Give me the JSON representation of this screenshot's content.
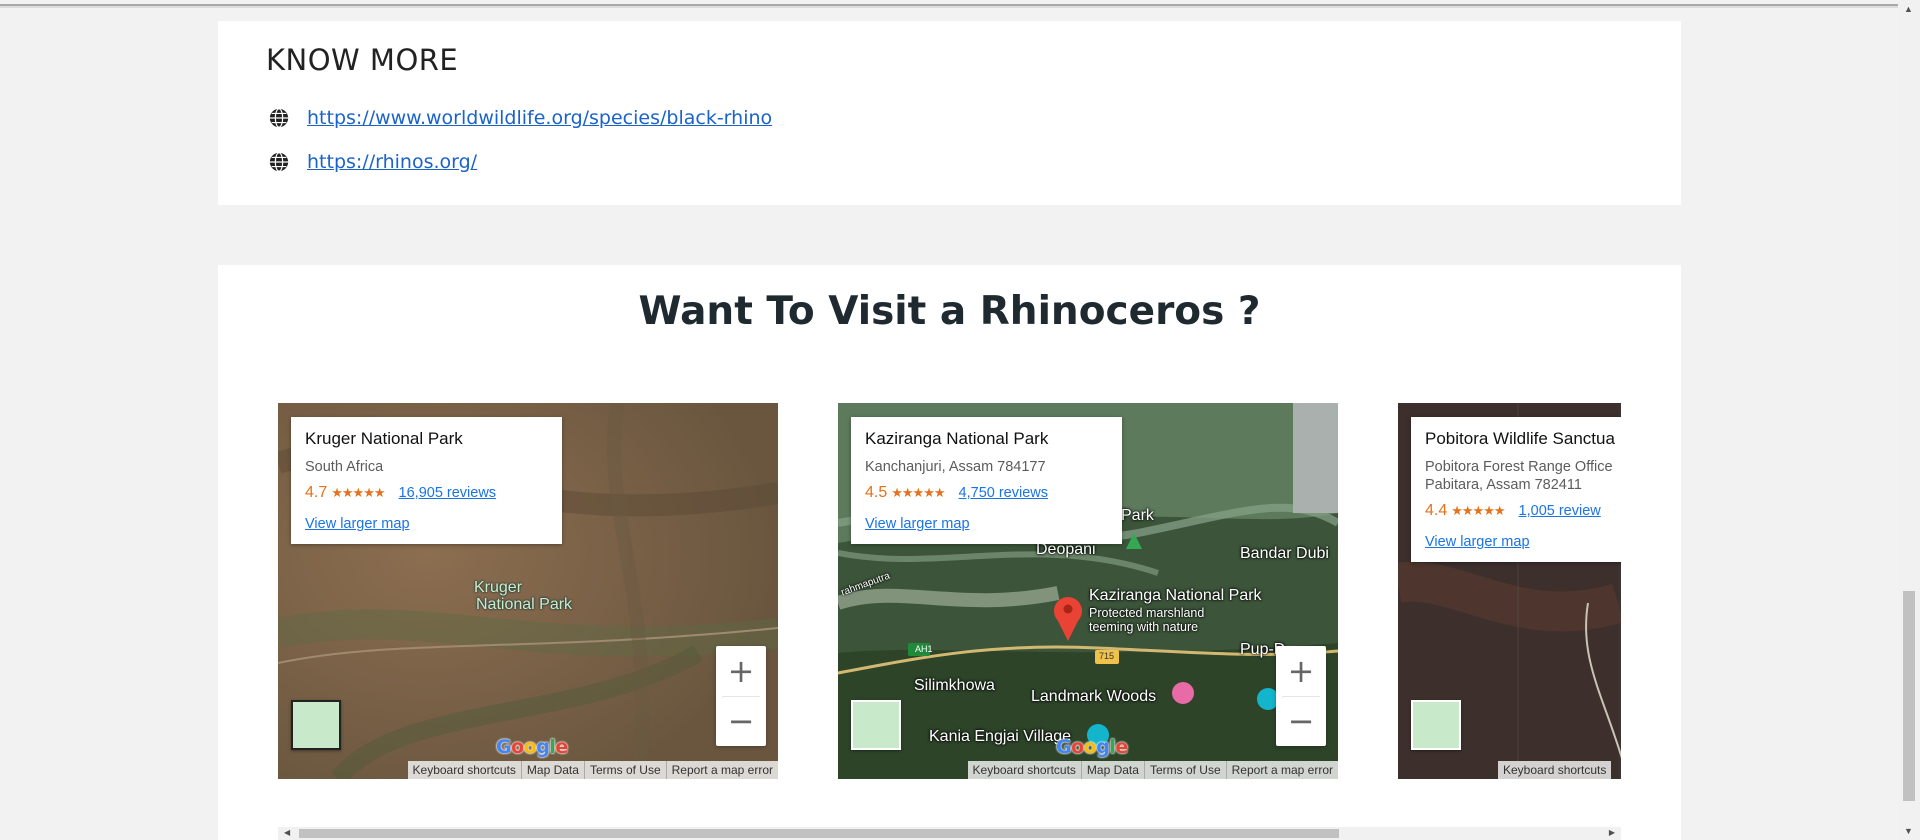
{
  "know_more": {
    "title": "KNOW MORE",
    "links": [
      {
        "icon": "globe-icon",
        "text": "https://www.worldwildlife.org/species/black-rhino"
      },
      {
        "icon": "globe-icon",
        "text": "https://rhinos.org/"
      }
    ]
  },
  "visit": {
    "title": "Want To Visit a Rhinoceros ?",
    "maps": [
      {
        "name": "Kruger National Park",
        "address_lines": [
          "South Africa"
        ],
        "score": "4.7",
        "stars": "★★★★★",
        "reviews": "16,905 reviews",
        "larger_map": "View larger map",
        "labels": [
          "Kruger",
          "National Park"
        ]
      },
      {
        "name": "Kaziranga National Park",
        "address_lines": [
          "Kanchanjuri, Assam 784177"
        ],
        "score": "4.5",
        "stars": "★★★★★",
        "reviews": "4,750 reviews",
        "larger_map": "View larger map",
        "labels": {
          "park": "Park",
          "deopani": "Deopani",
          "bandar": "Bandar Dubi",
          "kaziranga": "Kaziranga National Park",
          "protected1": "Protected marshland",
          "protected2": "teeming with nature",
          "pup": "Pup-D",
          "silim": "Silimkhowa",
          "landmark": "Landmark Woods",
          "kania": "Kania Engjai Village",
          "ah1": "AH1",
          "r715": "715",
          "brahm": "rahmaputra"
        }
      },
      {
        "name": "Pobitora Wildlife Sanctua",
        "address_lines": [
          "Pobitora Forest Range Office",
          "Pabitara, Assam 782411"
        ],
        "score": "4.4",
        "stars": "★★★★★",
        "reviews": "1,005 review",
        "larger_map": "View larger map"
      }
    ],
    "zoom_in": "+",
    "zoom_out": "−",
    "attribution": [
      "Keyboard shortcuts",
      "Map Data",
      "Terms of Use",
      "Report a map error"
    ],
    "google_logo": [
      "G",
      "o",
      "o",
      "g",
      "l",
      "e"
    ]
  },
  "colors": {
    "link": "#1a63c9",
    "rating": "#e7711b",
    "maps_link": "#1a73e8"
  }
}
